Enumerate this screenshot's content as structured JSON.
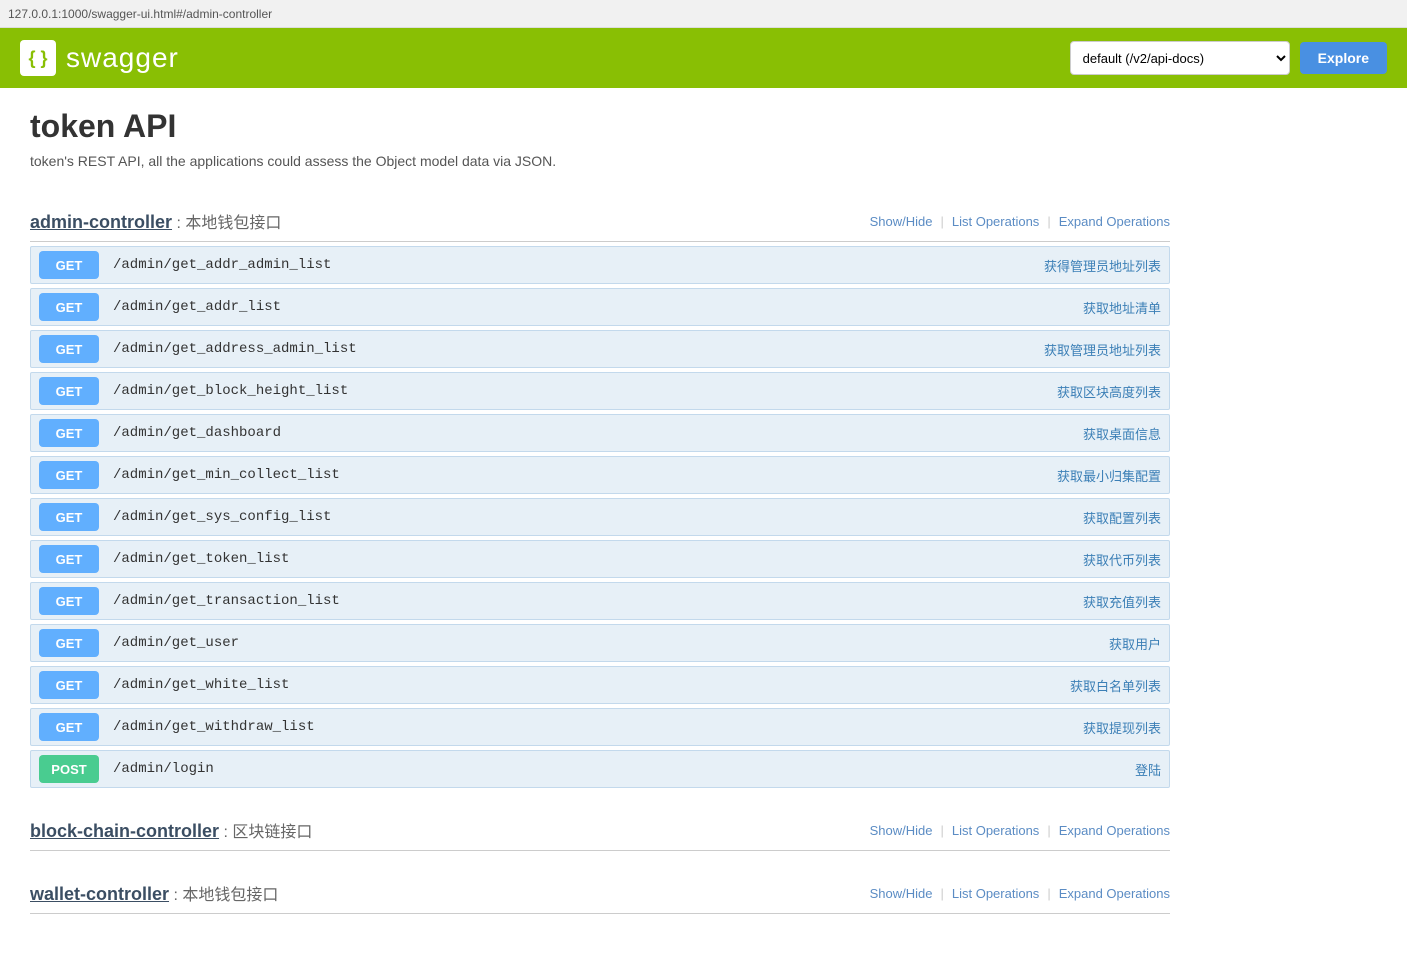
{
  "browser_bar": {
    "url": "127.0.0.1:1000/swagger-ui.html#/admin-controller"
  },
  "header": {
    "logo_symbol": "{ }",
    "logo_text": "swagger",
    "select_value": "default (/v2/api-docs)",
    "select_options": [
      "default (/v2/api-docs)"
    ],
    "explore_label": "Explore"
  },
  "api": {
    "title": "token API",
    "description": "token's REST API, all the applications could assess the Object model data via JSON."
  },
  "controllers": [
    {
      "id": "admin-controller",
      "name": "admin-controller",
      "colon": " : ",
      "label": "本地钱包接口",
      "actions": {
        "show_hide": "Show/Hide",
        "list_ops": "List Operations",
        "expand_ops": "Expand Operations"
      },
      "endpoints": [
        {
          "method": "GET",
          "path": "/admin/get_addr_admin_list",
          "desc": "获得管理员地址列表"
        },
        {
          "method": "GET",
          "path": "/admin/get_addr_list",
          "desc": "获取地址清单"
        },
        {
          "method": "GET",
          "path": "/admin/get_address_admin_list",
          "desc": "获取管理员地址列表"
        },
        {
          "method": "GET",
          "path": "/admin/get_block_height_list",
          "desc": "获取区块高度列表"
        },
        {
          "method": "GET",
          "path": "/admin/get_dashboard",
          "desc": "获取桌面信息"
        },
        {
          "method": "GET",
          "path": "/admin/get_min_collect_list",
          "desc": "获取最小归集配置"
        },
        {
          "method": "GET",
          "path": "/admin/get_sys_config_list",
          "desc": "获取配置列表"
        },
        {
          "method": "GET",
          "path": "/admin/get_token_list",
          "desc": "获取代币列表"
        },
        {
          "method": "GET",
          "path": "/admin/get_transaction_list",
          "desc": "获取充值列表"
        },
        {
          "method": "GET",
          "path": "/admin/get_user",
          "desc": "获取用户"
        },
        {
          "method": "GET",
          "path": "/admin/get_white_list",
          "desc": "获取白名单列表"
        },
        {
          "method": "GET",
          "path": "/admin/get_withdraw_list",
          "desc": "获取提现列表"
        },
        {
          "method": "POST",
          "path": "/admin/login",
          "desc": "登陆"
        }
      ]
    },
    {
      "id": "block-chain-controller",
      "name": "block-chain-controller",
      "colon": " : ",
      "label": "区块链接口",
      "actions": {
        "show_hide": "Show/Hide",
        "list_ops": "List Operations",
        "expand_ops": "Expand Operations"
      },
      "endpoints": []
    },
    {
      "id": "wallet-controller",
      "name": "wallet-controller",
      "colon": " : ",
      "label": "本地钱包接口",
      "actions": {
        "show_hide": "Show/Hide",
        "list_ops": "List Operations",
        "expand_ops": "Expand Operations"
      },
      "endpoints": []
    }
  ]
}
